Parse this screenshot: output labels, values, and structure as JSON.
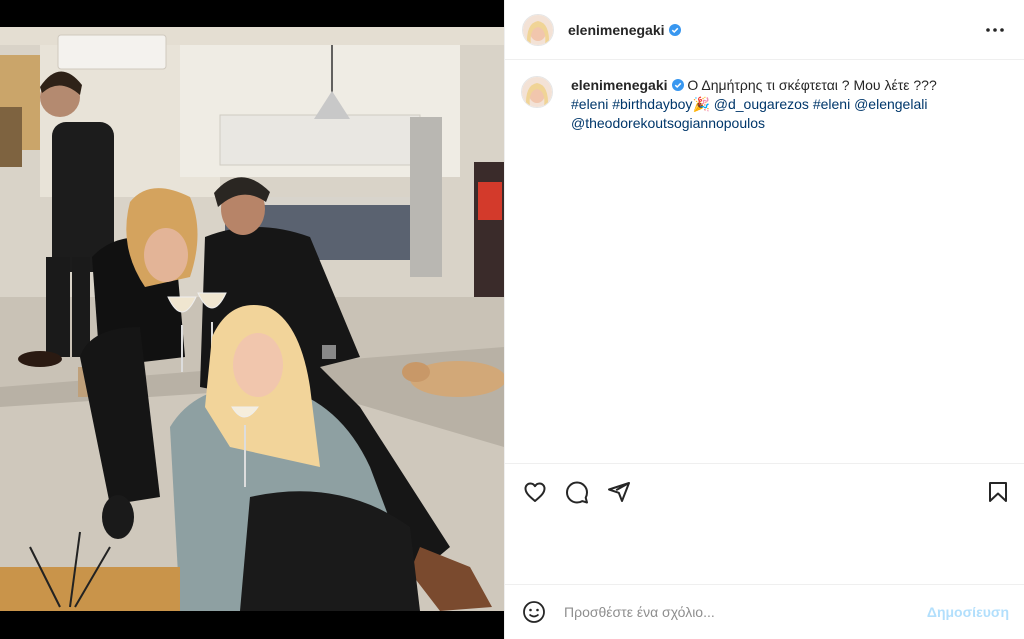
{
  "post": {
    "username": "elenimenegaki",
    "verified": true,
    "caption": {
      "username": "elenimenegaki",
      "text": " Ο Δημήτρης τι σκέφτεται ? Μου λέτε ???",
      "line2": [
        {
          "t": "#eleni",
          "type": "tag"
        },
        {
          "t": " ",
          "type": "text"
        },
        {
          "t": "#birthdayboy",
          "type": "tag"
        },
        {
          "t": "🎉",
          "type": "emoji"
        },
        {
          "t": " ",
          "type": "text"
        },
        {
          "t": "@d_ougarezos",
          "type": "tag"
        },
        {
          "t": " ",
          "type": "text"
        },
        {
          "t": "#eleni",
          "type": "tag"
        },
        {
          "t": " ",
          "type": "text"
        },
        {
          "t": "@elengelali",
          "type": "tag"
        }
      ],
      "line3": "@theodorekoutsogiannopoulos"
    },
    "actions": [
      "heart-icon",
      "comment-icon",
      "share-icon",
      "bookmark-icon"
    ],
    "comment_placeholder": "Προσθέστε ένα σχόλιο...",
    "post_button": "Δημοσίευση"
  },
  "colors": {
    "link": "#00376b",
    "verified": "#3897f0",
    "post_button_disabled": "#b2dffc"
  }
}
